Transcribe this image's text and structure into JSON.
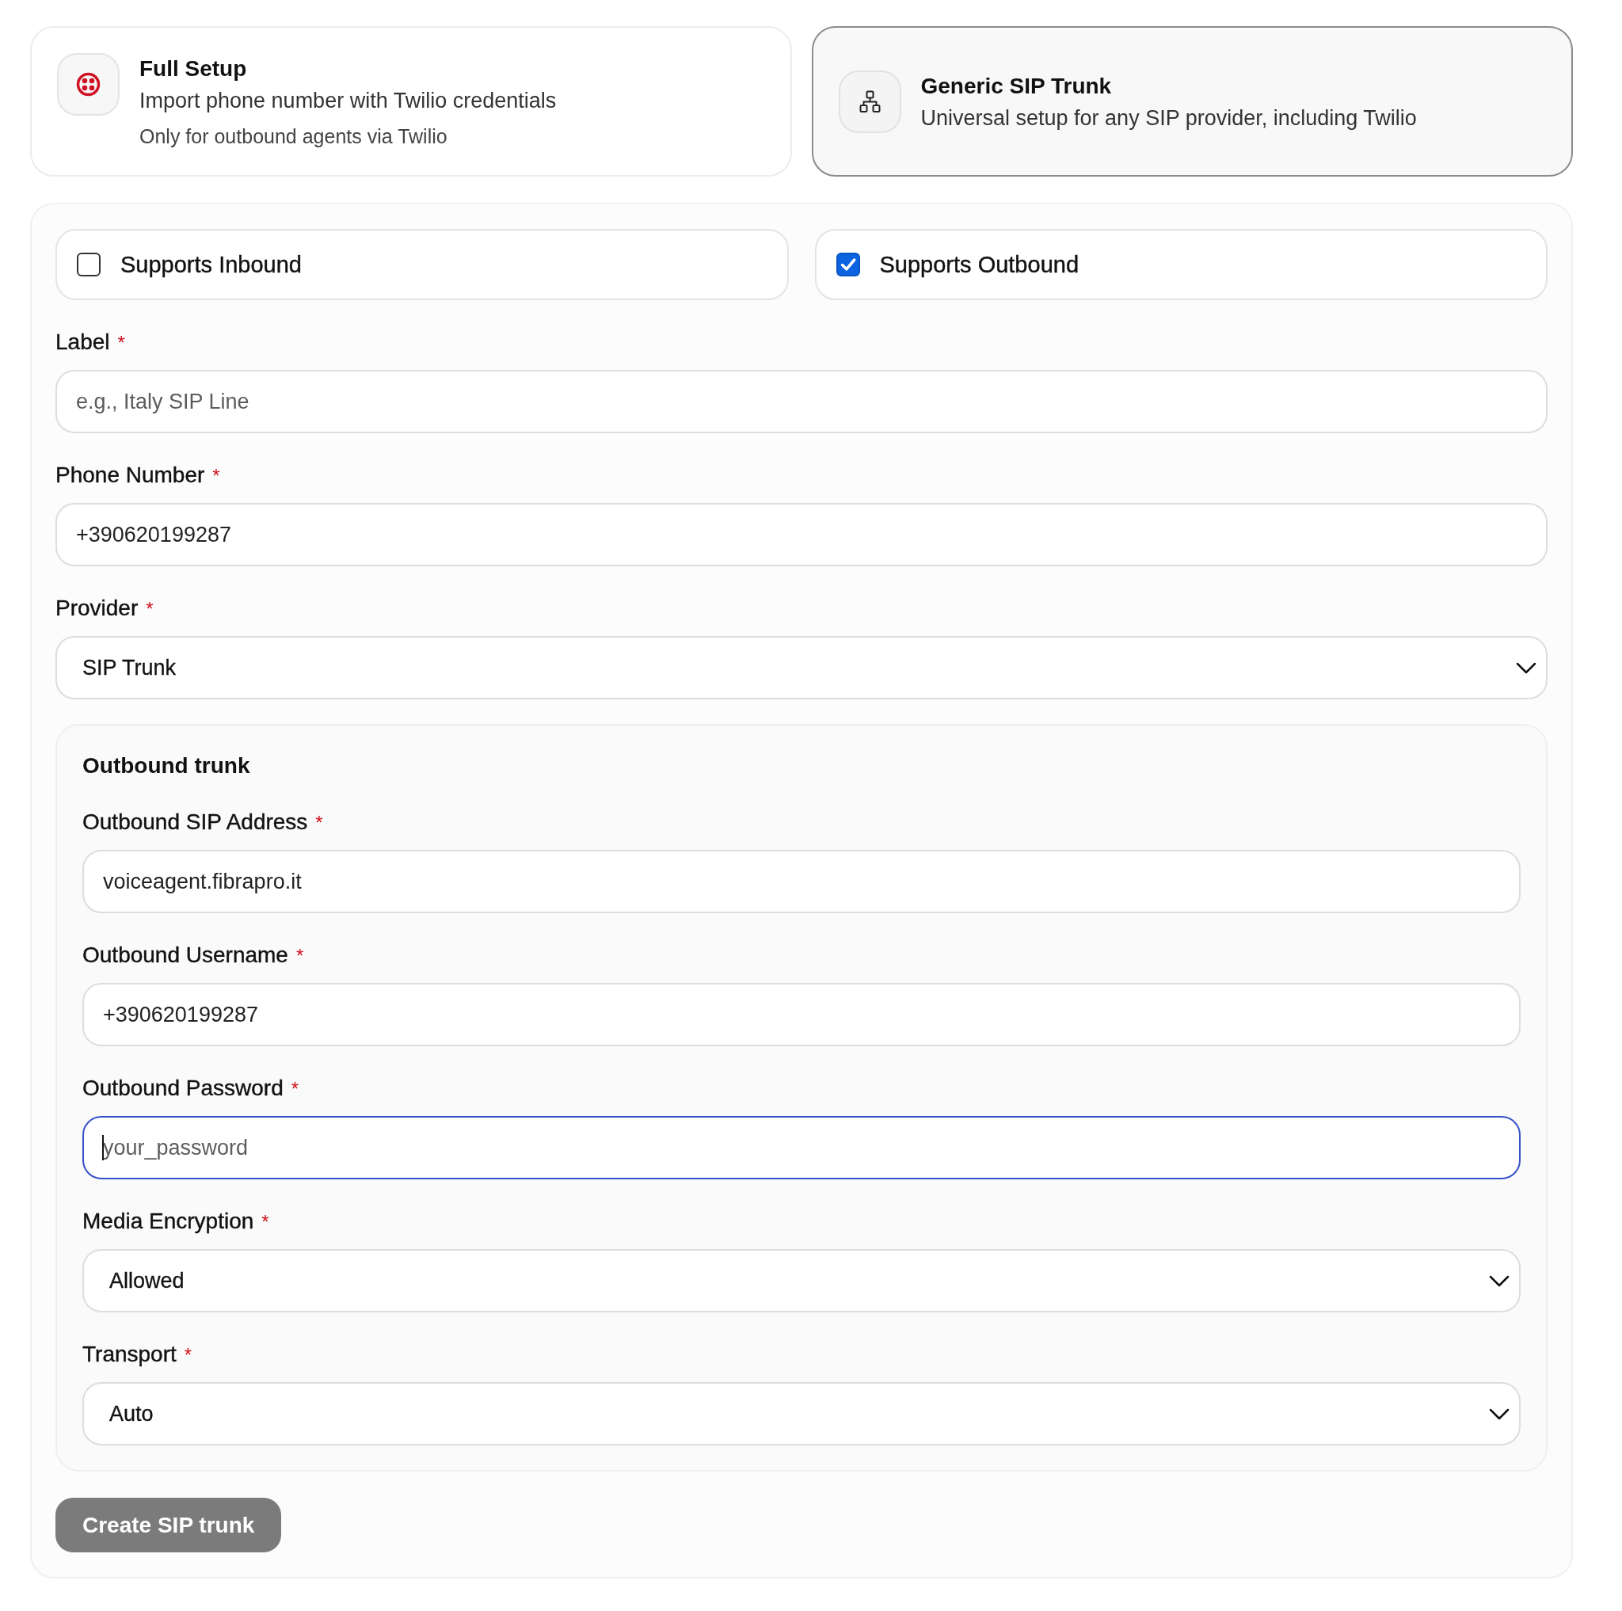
{
  "setup_options": [
    {
      "title": "Full Setup",
      "description": "Import phone number with Twilio credentials",
      "note": "Only for outbound agents via Twilio",
      "selected": false
    },
    {
      "title": "Generic SIP Trunk",
      "description": "Universal setup for any SIP provider, including Twilio",
      "selected": true
    }
  ],
  "direction_options": [
    {
      "label": "Supports Inbound",
      "checked": false
    },
    {
      "label": "Supports Outbound",
      "checked": true
    }
  ],
  "fields": [
    {
      "kind": "input",
      "label": "Label",
      "required_mark": "*",
      "placeholder": "e.g., Italy SIP Line",
      "focused": false
    },
    {
      "kind": "input",
      "label": "Phone Number",
      "required_mark": "*",
      "value": "+390620199287",
      "focused": false
    },
    {
      "kind": "select",
      "label": "Provider",
      "required_mark": "*",
      "value": "SIP Trunk",
      "focused": false
    }
  ],
  "outbound_trunk": {
    "title": "Outbound trunk",
    "fields": [
      {
        "kind": "input",
        "label": "Outbound SIP Address",
        "required_mark": "*",
        "value": "voiceagent.fibrapro.it",
        "focused": false
      },
      {
        "kind": "input",
        "label": "Outbound Username",
        "required_mark": "*",
        "value": "+390620199287",
        "focused": false
      },
      {
        "kind": "input",
        "label": "Outbound Password",
        "required_mark": "*",
        "placeholder": "your_password",
        "focused": true
      },
      {
        "kind": "select",
        "label": "Media Encryption",
        "required_mark": "*",
        "value": "Allowed",
        "focused": false
      },
      {
        "kind": "select",
        "label": "Transport",
        "required_mark": "*",
        "value": "Auto",
        "focused": false
      }
    ]
  },
  "submit_button": {
    "label": "Create SIP trunk",
    "disabled": true
  }
}
